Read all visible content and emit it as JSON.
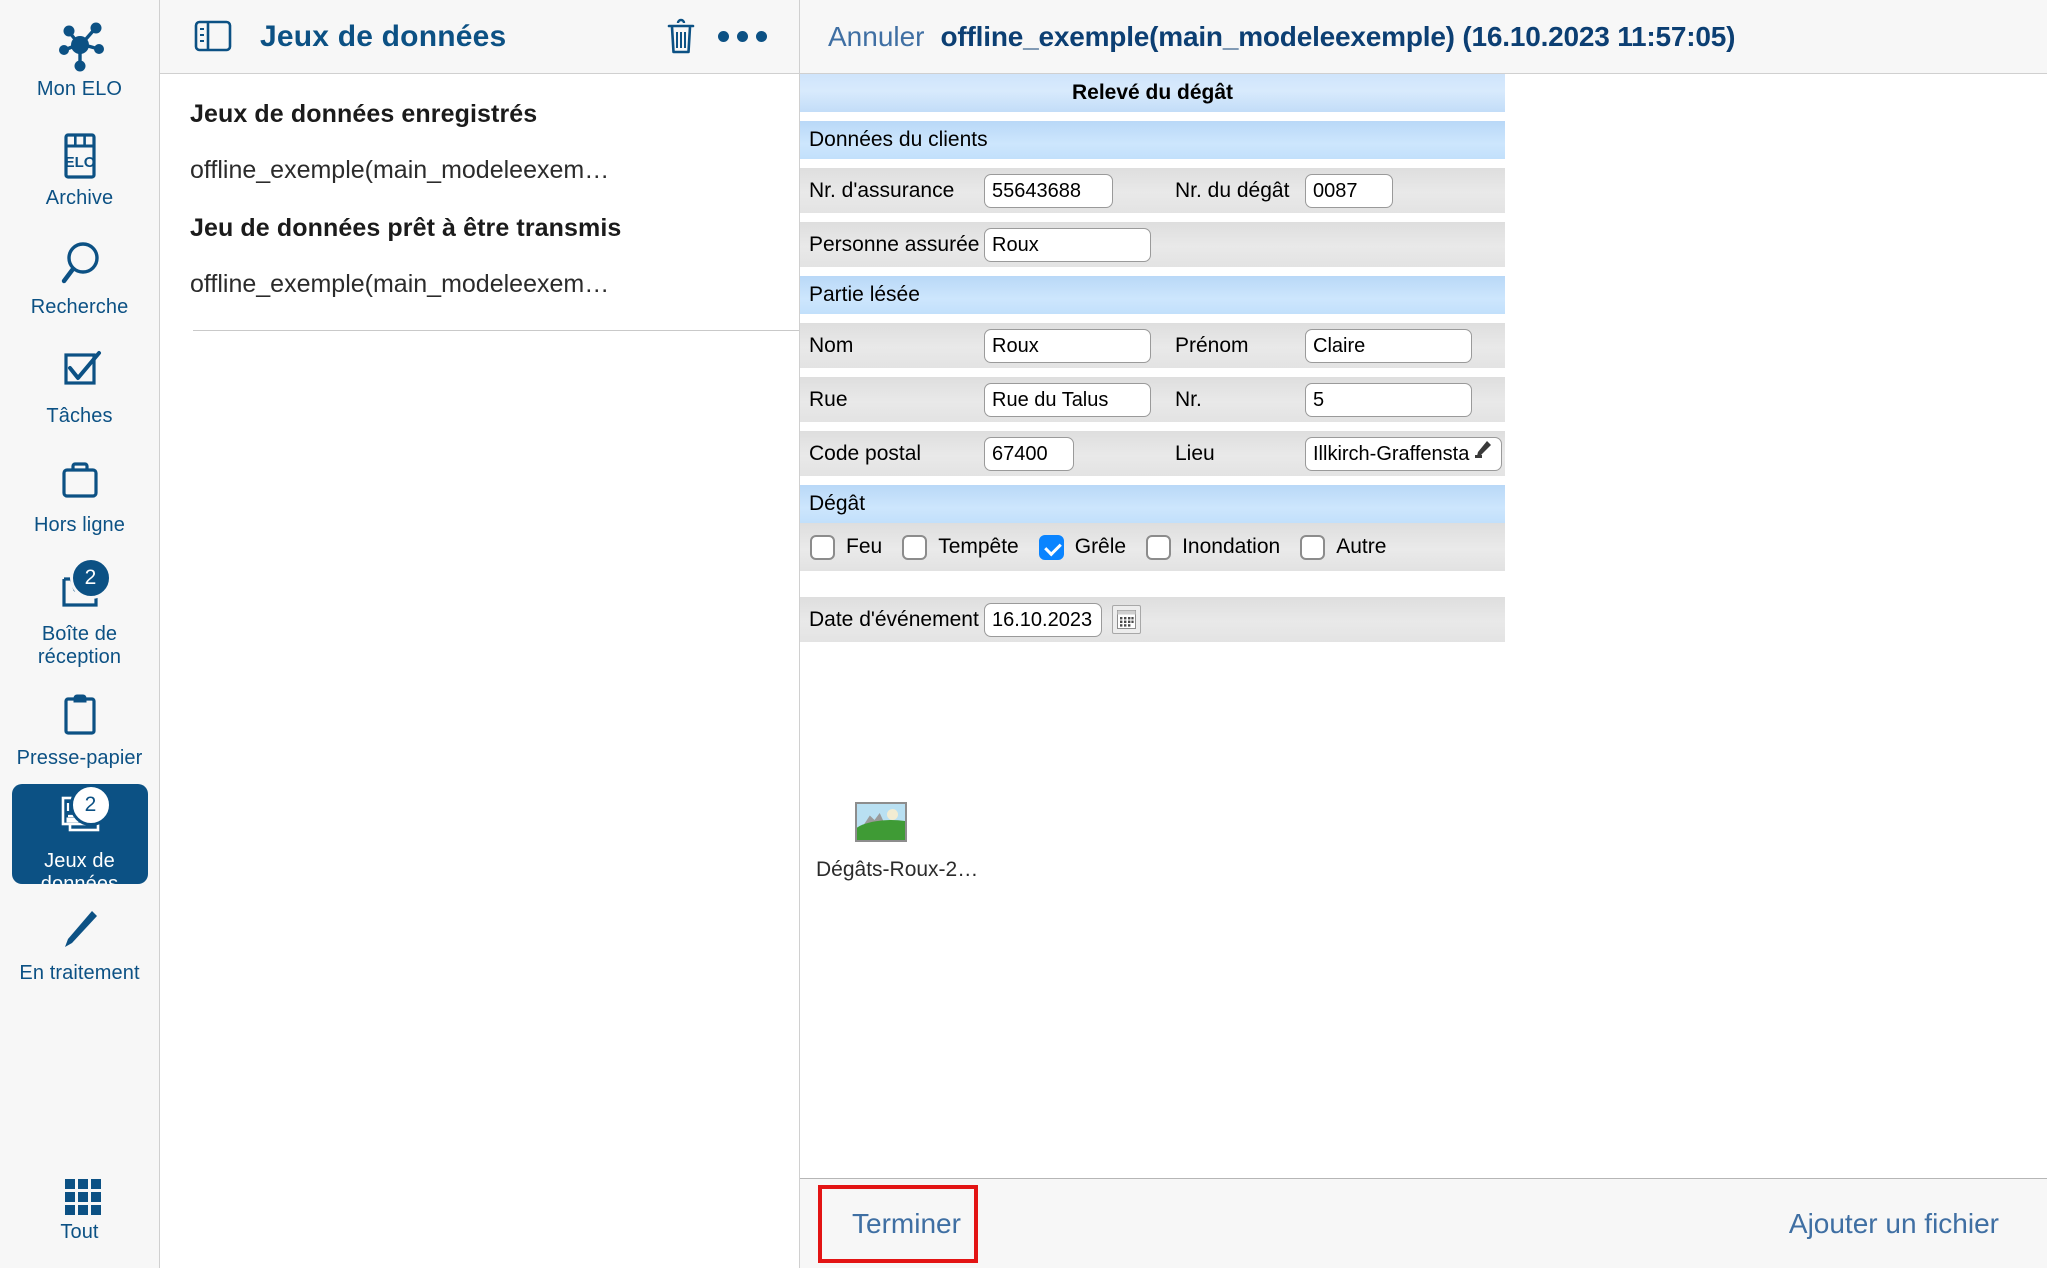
{
  "sidebar": {
    "items": [
      {
        "label": "Mon ELO",
        "icon": "network-nodes-icon",
        "badge": null,
        "active": false
      },
      {
        "label": "Archive",
        "icon": "elo-archive-icon",
        "badge": null,
        "active": false
      },
      {
        "label": "Recherche",
        "icon": "search-icon",
        "badge": null,
        "active": false
      },
      {
        "label": "Tâches",
        "icon": "checkbox-task-icon",
        "badge": null,
        "active": false
      },
      {
        "label": "Hors ligne",
        "icon": "briefcase-icon",
        "badge": null,
        "active": false
      },
      {
        "label": "Boîte de réception",
        "icon": "inbox-tray-icon",
        "badge": "2",
        "active": false
      },
      {
        "label": "Presse-papier",
        "icon": "clipboard-icon",
        "badge": null,
        "active": false
      },
      {
        "label": "Jeux de données",
        "icon": "dataset-form-icon",
        "badge": "2",
        "active": true
      },
      {
        "label": "En traitement",
        "icon": "pencil-icon",
        "badge": null,
        "active": false
      },
      {
        "label": "Tout",
        "icon": "grid-apps-icon",
        "badge": null,
        "active": false
      }
    ]
  },
  "list_panel": {
    "toolbar": {
      "panel_toggle_icon": "split-panel-icon",
      "title": "Jeux de données",
      "delete_icon": "trash-icon",
      "more_icon": "more-options-icon"
    },
    "sections": [
      {
        "header": "Jeux de données enregistrés",
        "items": [
          "offline_exemple(main_modeleexem…"
        ]
      },
      {
        "header": "Jeu de données prêt à être transmis",
        "items": [
          "offline_exemple(main_modeleexem…"
        ]
      }
    ]
  },
  "detail": {
    "header": {
      "cancel_label": "Annuler",
      "document_title": "offline_exemple(main_modeleexemple) (16.10.2023 11:57:05)"
    },
    "form": {
      "title": "Relevé du dégât",
      "sections": [
        {
          "heading": "Données du clients",
          "rows": [
            {
              "fields": [
                {
                  "label": "Nr. d'assurance",
                  "value": "55643688"
                },
                {
                  "label": "Nr. du dégât",
                  "value": "0087"
                }
              ]
            },
            {
              "fields": [
                {
                  "label": "Personne assurée",
                  "value": "Roux"
                }
              ]
            }
          ]
        },
        {
          "heading": "Partie lésée",
          "rows": [
            {
              "fields": [
                {
                  "label": "Nom",
                  "value": "Roux"
                },
                {
                  "label": "Prénom",
                  "value": "Claire"
                }
              ]
            },
            {
              "fields": [
                {
                  "label": "Rue",
                  "value": "Rue du Talus"
                },
                {
                  "label": "Nr.",
                  "value": "5"
                }
              ]
            },
            {
              "fields": [
                {
                  "label": "Code postal",
                  "value": "67400"
                },
                {
                  "label": "Lieu",
                  "value": "Illkirch-Graffenstader",
                  "icon": "pencil-edit-icon"
                }
              ]
            }
          ]
        },
        {
          "heading": "Dégât",
          "checkboxes": [
            {
              "label": "Feu",
              "checked": false
            },
            {
              "label": "Tempête",
              "checked": false
            },
            {
              "label": "Grêle",
              "checked": true
            },
            {
              "label": "Inondation",
              "checked": false
            },
            {
              "label": "Autre",
              "checked": false
            }
          ]
        }
      ],
      "date_row": {
        "label": "Date d'événement",
        "value": "16.10.2023",
        "calendar_icon": "calendar-icon"
      }
    },
    "attachment": {
      "icon": "image-thumbnail-icon",
      "name": "Dégâts-Roux-2…"
    },
    "footer": {
      "finish_label": "Terminer",
      "add_file_label": "Ajouter un fichier"
    }
  },
  "colors": {
    "brand": "#0c5184",
    "link": "#3f6fa3",
    "checkbox_checked": "#0a84ff",
    "highlight_border": "#e31414",
    "section_blue": "#c3ddf8",
    "row_gray": "#e3e3e3"
  }
}
